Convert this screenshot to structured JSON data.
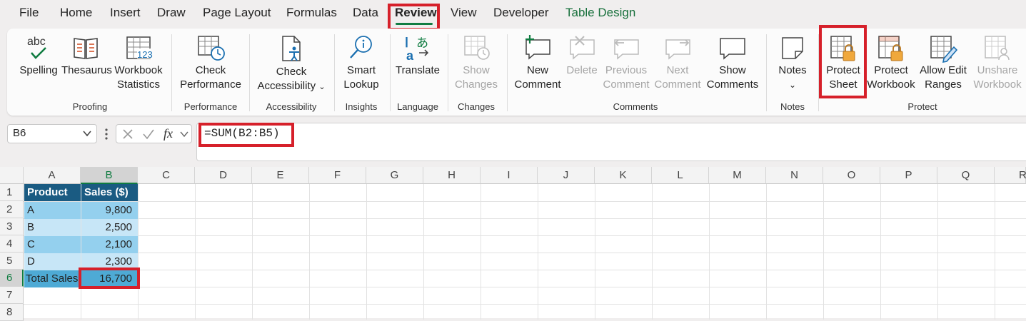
{
  "menu": {
    "tabs": [
      "File",
      "Home",
      "Insert",
      "Draw",
      "Page Layout",
      "Formulas",
      "Data",
      "Review",
      "View",
      "Developer",
      "Table Design"
    ],
    "active": "Review"
  },
  "ribbon": {
    "proofing": {
      "group": "Proofing",
      "spelling": {
        "line1": "Spelling",
        "icon_text": "abc"
      },
      "thesaurus": {
        "line1": "Thesaurus"
      },
      "workbook_stats": {
        "line1": "Workbook",
        "line2": "Statistics",
        "icon_text": "123"
      }
    },
    "performance": {
      "group": "Performance",
      "check_performance": {
        "line1": "Check",
        "line2": "Performance"
      }
    },
    "accessibility": {
      "group": "Accessibility",
      "check_accessibility": {
        "line1": "Check",
        "line2": "Accessibility"
      }
    },
    "insights": {
      "group": "Insights",
      "smart_lookup": {
        "line1": "Smart",
        "line2": "Lookup"
      }
    },
    "language": {
      "group": "Language",
      "translate": {
        "line1": "Translate"
      }
    },
    "changes": {
      "group": "Changes",
      "show_changes": {
        "line1": "Show",
        "line2": "Changes"
      }
    },
    "comments": {
      "group": "Comments",
      "new_comment": {
        "line1": "New",
        "line2": "Comment"
      },
      "delete": {
        "line1": "Delete"
      },
      "previous_comment": {
        "line1": "Previous",
        "line2": "Comment"
      },
      "next_comment": {
        "line1": "Next",
        "line2": "Comment"
      },
      "show_comments": {
        "line1": "Show",
        "line2": "Comments"
      }
    },
    "notes": {
      "group": "Notes",
      "notes": {
        "line1": "Notes"
      }
    },
    "protect": {
      "group": "Protect",
      "protect_sheet": {
        "line1": "Protect",
        "line2": "Sheet"
      },
      "protect_workbook": {
        "line1": "Protect",
        "line2": "Workbook"
      },
      "allow_edit_ranges": {
        "line1": "Allow Edit",
        "line2": "Ranges"
      },
      "unshare_workbook": {
        "line1": "Unshare",
        "line2": "Workbook"
      }
    }
  },
  "formula_bar": {
    "name_box": "B6",
    "fx_label": "fx",
    "formula": "=SUM(B2:B5)"
  },
  "sheet": {
    "columns": [
      "A",
      "B",
      "C",
      "D",
      "E",
      "F",
      "G",
      "H",
      "I",
      "J",
      "K",
      "L",
      "M",
      "N",
      "O",
      "P",
      "Q",
      "R"
    ],
    "rows": [
      "1",
      "2",
      "3",
      "4",
      "5",
      "6",
      "7",
      "8"
    ],
    "selected_cell": "B6",
    "table": {
      "headers": [
        "Product",
        "Sales ($)"
      ],
      "rows": [
        [
          "A",
          "9,800"
        ],
        [
          "B",
          "2,500"
        ],
        [
          "C",
          "2,100"
        ],
        [
          "D",
          "2,300"
        ]
      ],
      "total": [
        "Total Sales",
        "16,700"
      ]
    }
  },
  "colors": {
    "accent_green": "#107c41",
    "highlight_red": "#d6202a",
    "table_header": "#1a5b82",
    "band_dark": "#94d0ee",
    "band_light": "#c7e6f7"
  }
}
